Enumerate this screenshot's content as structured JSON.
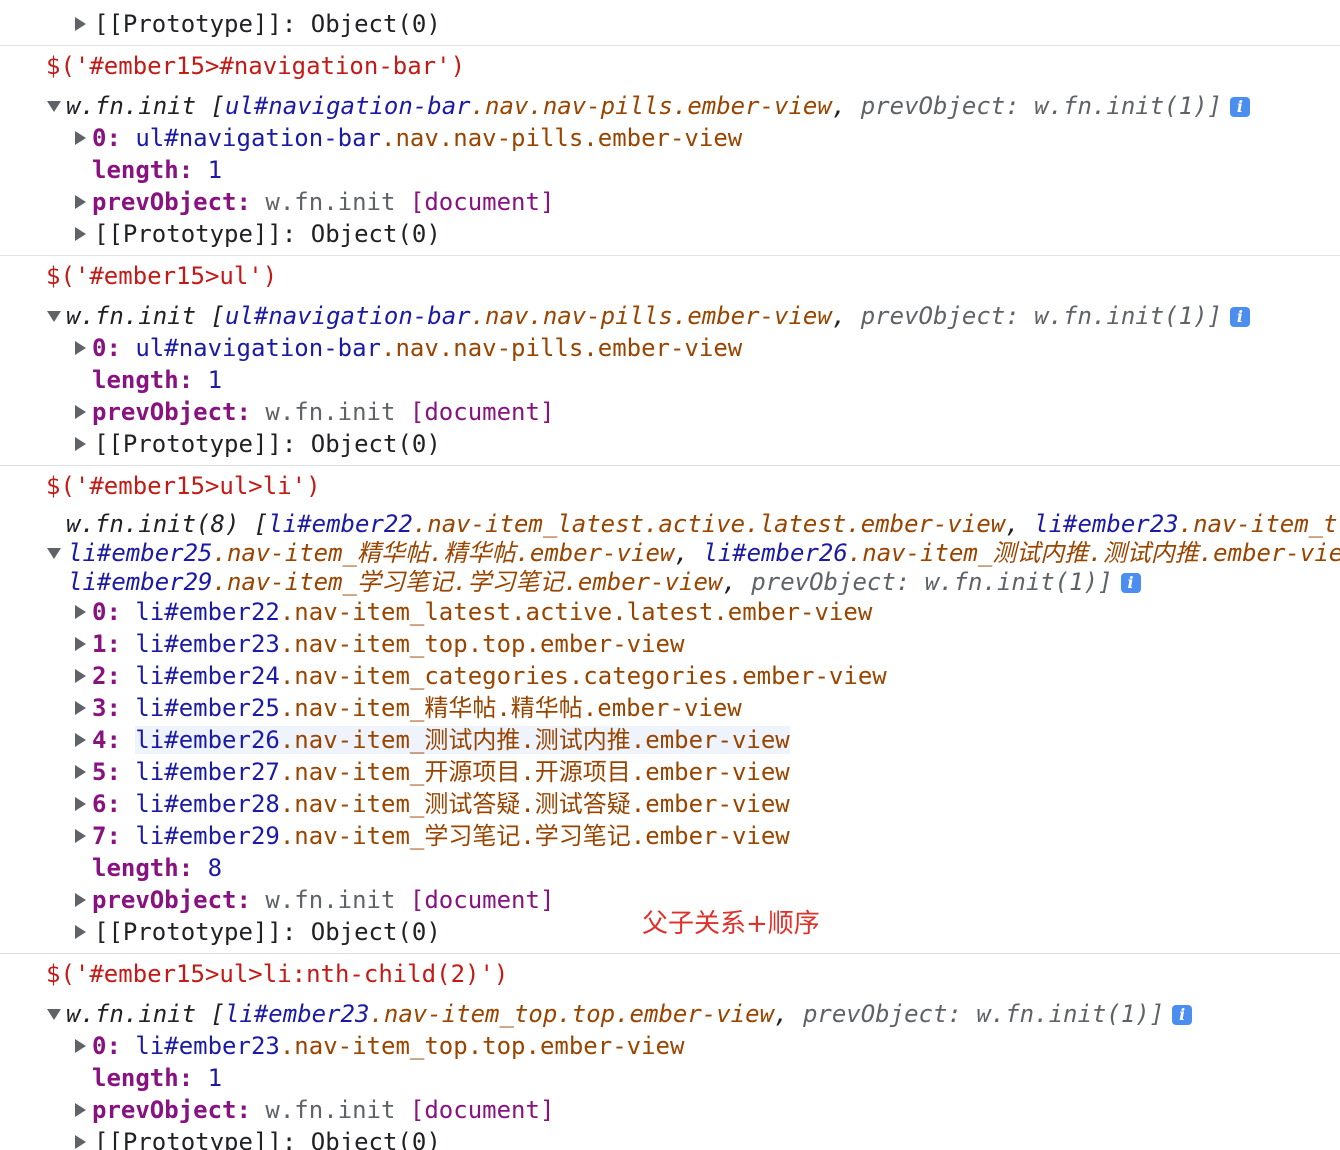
{
  "top": {
    "proto": "[[Prototype]]: Object(0)"
  },
  "blocks": [
    {
      "input": "$('#ember15>#navigation-bar')",
      "summary_head": "w.fn.init [",
      "summary_items": [
        "ul#navigation-bar",
        ".nav.nav-pills.ember-view"
      ],
      "summary_tail": "prevObject: w.fn.init(1)]",
      "rows": [
        {
          "key": "0",
          "tag": "ul#navigation-bar",
          "cls": ".nav.nav-pills.ember-view"
        },
        {
          "key": "length",
          "num": "1"
        },
        {
          "key": "prevObject",
          "text": "w.fn.init",
          "doc": "[document]"
        },
        {
          "proto": "[[Prototype]]: Object(0)"
        }
      ]
    },
    {
      "input": "$('#ember15>ul')",
      "summary_head": "w.fn.init [",
      "summary_items": [
        "ul#navigation-bar",
        ".nav.nav-pills.ember-view"
      ],
      "summary_tail": "prevObject: w.fn.init(1)]",
      "rows": [
        {
          "key": "0",
          "tag": "ul#navigation-bar",
          "cls": ".nav.nav-pills.ember-view"
        },
        {
          "key": "length",
          "num": "1"
        },
        {
          "key": "prevObject",
          "text": "w.fn.init",
          "doc": "[document]"
        },
        {
          "proto": "[[Prototype]]: Object(0)"
        }
      ]
    },
    {
      "input": "$('#ember15>ul>li')",
      "summary_lines": [
        [
          "w.fn.init(8) [",
          "li#ember22",
          ".nav-item_latest.active.latest.ember-view",
          ", ",
          "li#ember23",
          ".nav-item_t"
        ],
        [
          "li#ember25",
          ".nav-item_精华帖.精华帖.ember-view",
          ", ",
          "li#ember26",
          ".nav-item_测试内推.测试内推.ember-vie"
        ],
        [
          "li#ember29",
          ".nav-item_学习笔记.学习笔记.ember-view",
          ", ",
          "prevObject: w.fn.init(1)]"
        ]
      ],
      "rows": [
        {
          "key": "0",
          "tag": "li#ember22",
          "cls": ".nav-item_latest.active.latest.ember-view"
        },
        {
          "key": "1",
          "tag": "li#ember23",
          "cls": ".nav-item_top.top.ember-view"
        },
        {
          "key": "2",
          "tag": "li#ember24",
          "cls": ".nav-item_categories.categories.ember-view"
        },
        {
          "key": "3",
          "tag": "li#ember25",
          "cls": ".nav-item_精华帖.精华帖.ember-view"
        },
        {
          "key": "4",
          "tag": "li#ember26",
          "cls": ".nav-item_测试内推.测试内推.ember-view"
        },
        {
          "key": "5",
          "tag": "li#ember27",
          "cls": ".nav-item_开源项目.开源项目.ember-view"
        },
        {
          "key": "6",
          "tag": "li#ember28",
          "cls": ".nav-item_测试答疑.测试答疑.ember-view"
        },
        {
          "key": "7",
          "tag": "li#ember29",
          "cls": ".nav-item_学习笔记.学习笔记.ember-view"
        },
        {
          "key": "length",
          "num": "8"
        },
        {
          "key": "prevObject",
          "text": "w.fn.init",
          "doc": "[document]"
        },
        {
          "proto": "[[Prototype]]: Object(0)"
        }
      ]
    },
    {
      "input": "$('#ember15>ul>li:nth-child(2)')",
      "summary_head": "w.fn.init [",
      "summary_items": [
        "li#ember23",
        ".nav-item_top.top.ember-view"
      ],
      "summary_tail": "prevObject: w.fn.init(1)]",
      "rows": [
        {
          "key": "0",
          "tag": "li#ember23",
          "cls": ".nav-item_top.top.ember-view"
        },
        {
          "key": "length",
          "num": "1"
        },
        {
          "key": "prevObject",
          "text": "w.fn.init",
          "doc": "[document]"
        },
        {
          "proto": "[[Prototype]]: Object(0)"
        }
      ]
    }
  ],
  "annotation": "父子关系+顺序",
  "colors": {
    "string": "#c41a16",
    "tag": "#1a1aa6",
    "class": "#994500",
    "key": "#881280",
    "annotation": "#e0302a",
    "info": "#4b8ef0"
  },
  "icons": {
    "prompt": "chevron-right-icon",
    "result": "return-arrow-icon",
    "expand": "expand-triangle-icon",
    "info": "info-icon"
  }
}
